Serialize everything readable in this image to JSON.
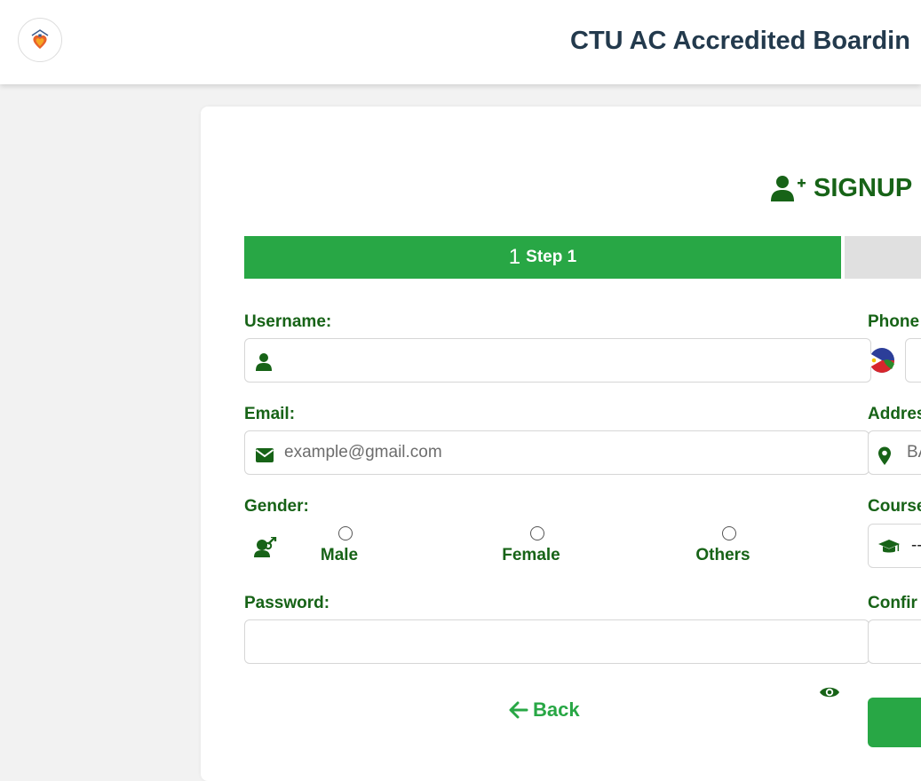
{
  "header": {
    "title": "CTU AC Accredited Boardin"
  },
  "form": {
    "heading": "SIGNUP",
    "steps": [
      {
        "number": "1",
        "label": "Step 1",
        "active": true
      }
    ],
    "fields": {
      "username": {
        "label": "Username:",
        "value": ""
      },
      "phone": {
        "label": "Phone",
        "value": ""
      },
      "email": {
        "label": "Email:",
        "placeholder": "example@gmail.com"
      },
      "address": {
        "label": "Addres",
        "placeholder": "BA"
      },
      "gender": {
        "label": "Gender:",
        "options": [
          "Male",
          "Female",
          "Others"
        ]
      },
      "course": {
        "label": "Course",
        "value": "--"
      },
      "password": {
        "label": "Password:",
        "value": ""
      },
      "confirm": {
        "label": "Confir",
        "value": ""
      }
    },
    "back_label": "Back"
  },
  "colors": {
    "brand_green": "#28a745",
    "label_green": "#176317",
    "title_navy": "#233a4d"
  },
  "icons": {
    "logo": "home-heart-logo",
    "username": "user-icon",
    "email": "envelope-icon",
    "address": "map-marker-icon",
    "gender": "gender-icon",
    "course": "graduation-cap-icon",
    "password_toggle": "eye-icon",
    "phone_country": "philippines-flag-icon",
    "signup": "user-plus-icon",
    "back": "arrow-left-icon"
  }
}
